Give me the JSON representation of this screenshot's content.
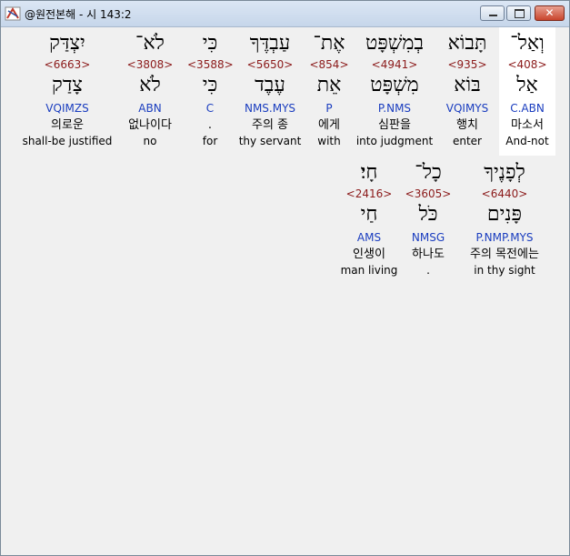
{
  "window": {
    "title": "@원전본해 - 시 143:2",
    "app_icon": "bible-app-icon",
    "minimize_icon": "minimize-icon",
    "maximize_icon": "maximize-icon",
    "close_icon": "close-icon",
    "close_glyph": "✕"
  },
  "row1": [
    {
      "heb": "וְאַל־",
      "strong": "<408>",
      "root": "אַל",
      "morph": "C.ABN",
      "ko": "마소서",
      "en": "And-not"
    },
    {
      "heb": "תָּבוֹא",
      "strong": "<935>",
      "root": "בּוֹא",
      "morph": "VQIMYS",
      "ko": "행치",
      "en": "enter"
    },
    {
      "heb": "בְמִשְׁפָּט",
      "strong": "<4941>",
      "root": "מִשְׁפָּט",
      "morph": "P.NMS",
      "ko": "심판을",
      "en": "into judgment"
    },
    {
      "heb": "אֶת־",
      "strong": "<854>",
      "root": "אֵת",
      "morph": "P",
      "ko": "에게",
      "en": "with"
    },
    {
      "heb": "עַבְדֶּךָ",
      "strong": "<5650>",
      "root": "עֶבֶד",
      "morph": "NMS.MYS",
      "ko": "주의 종",
      "en": "thy servant"
    },
    {
      "heb": "כִּי",
      "strong": "<3588>",
      "root": "כִּי",
      "morph": "C",
      "ko": ".",
      "en": "for"
    },
    {
      "heb": "לֹא־",
      "strong": "<3808>",
      "root": "לֹא",
      "morph": "ABN",
      "ko": "없나이다",
      "en": "no"
    },
    {
      "heb": "יִצְדַּק",
      "strong": "<6663>",
      "root": "צָדַק",
      "morph": "VQIMZS",
      "ko": "의로운",
      "en": "shall-be justified"
    }
  ],
  "row2": [
    {
      "heb": "לְפָנֶיךָ",
      "strong": "<6440>",
      "root": "פָּנִים",
      "morph": "P.NMP.MYS",
      "ko": "주의 목전에는",
      "en": "in thy sight"
    },
    {
      "heb": "כָל־",
      "strong": "<3605>",
      "root": "כֹּל",
      "morph": "NMSG",
      "ko": "하나도",
      "en": "."
    },
    {
      "heb": "חָי׃",
      "strong": "<2416>",
      "root": "חַי",
      "morph": "AMS",
      "ko": "인생이",
      "en": "man living"
    }
  ]
}
